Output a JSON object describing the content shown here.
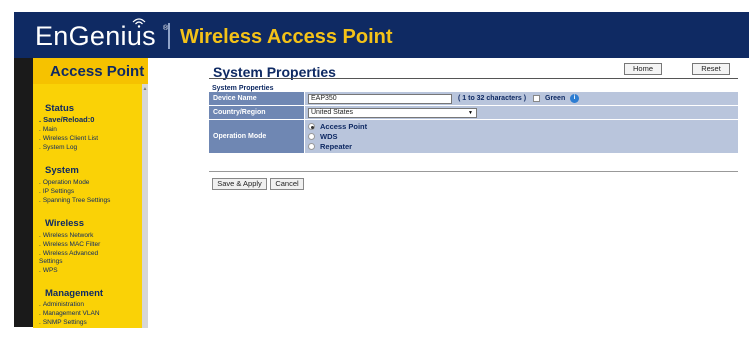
{
  "header": {
    "brand": "EnGenius",
    "reg_mark": "®",
    "title": "Wireless Access Point"
  },
  "sidebar": {
    "title": "Access Point",
    "sections": [
      {
        "label": "Status",
        "items": [
          "Save/Reload:0",
          "Main",
          "Wireless Client List",
          "System Log"
        ]
      },
      {
        "label": "System",
        "items": [
          "Operation Mode",
          "IP Settings",
          "Spanning Tree Settings"
        ]
      },
      {
        "label": "Wireless",
        "items": [
          "Wireless Network",
          "Wireless MAC Filter",
          "Wireless Advanced Settings",
          "WPS"
        ]
      },
      {
        "label": "Management",
        "items": [
          "Administration",
          "Management VLAN",
          "SNMP Settings"
        ]
      }
    ]
  },
  "main": {
    "title": "System Properties",
    "home_label": "Home",
    "reset_label": "Reset",
    "section_label": "System Properties",
    "device_name": {
      "label": "Device Name",
      "value": "EAP350",
      "hint": "( 1 to 32 characters )",
      "green_label": "Green",
      "green_checked": false
    },
    "country": {
      "label": "Country/Region",
      "value": "United States"
    },
    "operation_mode": {
      "label": "Operation Mode",
      "options": [
        "Access Point",
        "WDS",
        "Repeater"
      ],
      "selected": "Access Point"
    },
    "save_label": "Save & Apply",
    "cancel_label": "Cancel"
  },
  "colors": {
    "header_bg": "#0f2a63",
    "title_yellow": "#f4c218",
    "sidebar_bg": "#fad206",
    "label_cell": "#6f87b3",
    "value_cell": "#b9c5dc"
  },
  "icons": [
    "wifi-logo-icon",
    "info-icon",
    "dropdown-arrow-icon"
  ]
}
